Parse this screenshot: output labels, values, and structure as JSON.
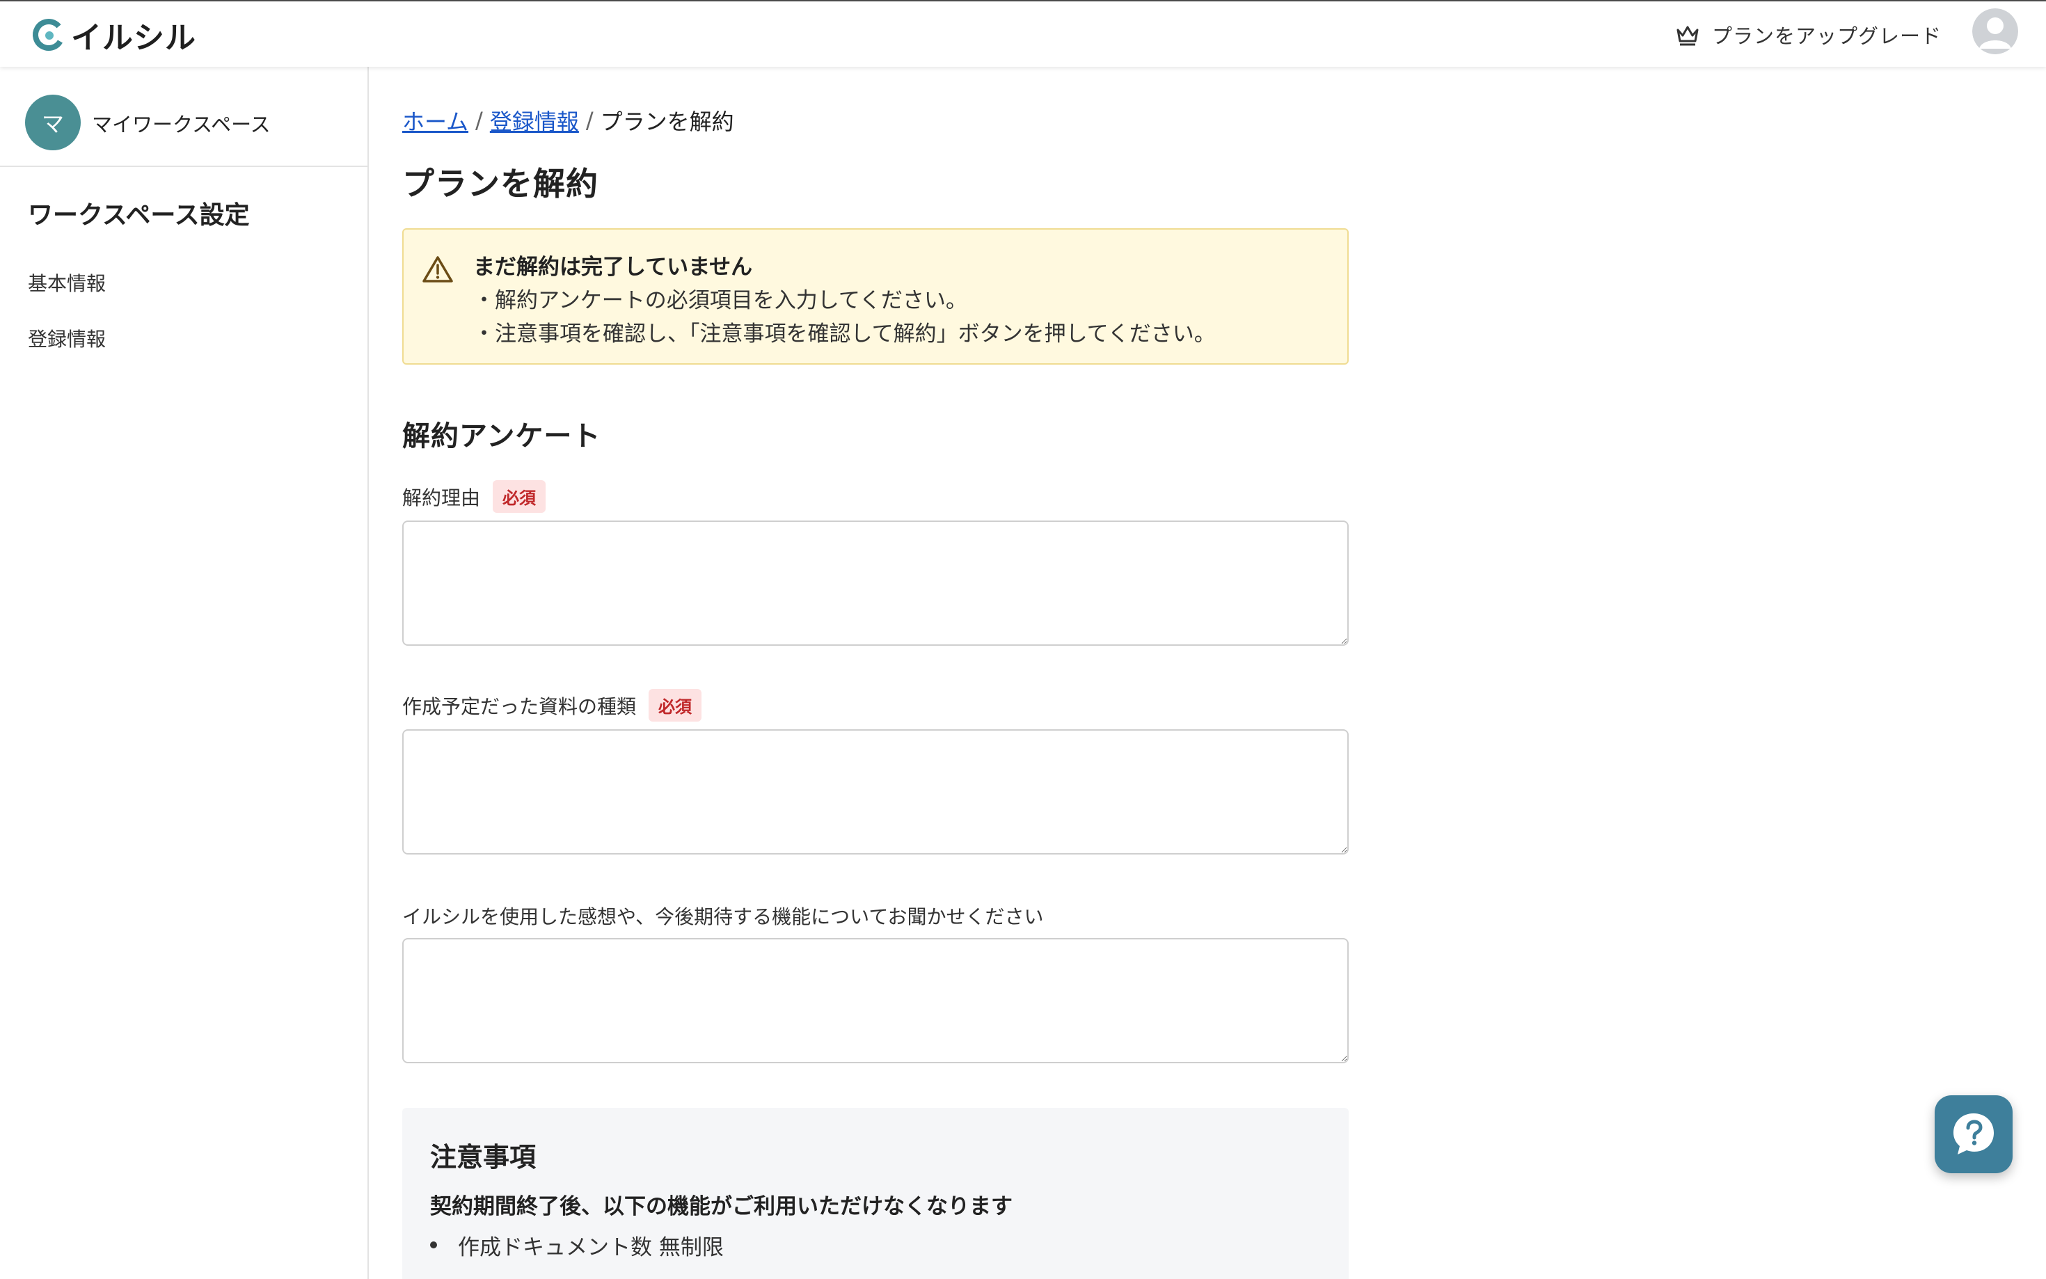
{
  "header": {
    "app_name": "イルシル",
    "upgrade_label": "プランをアップグレード"
  },
  "sidebar": {
    "workspace_initial": "マ",
    "workspace_name": "マイワークスペース",
    "section_title": "ワークスペース設定",
    "items": [
      {
        "label": "基本情報"
      },
      {
        "label": "登録情報"
      }
    ]
  },
  "breadcrumb": {
    "home": "ホーム",
    "registration": "登録情報",
    "current": "プランを解約",
    "separator": "/"
  },
  "page": {
    "title": "プランを解約"
  },
  "alert": {
    "title": "まだ解約は完了していません",
    "lines": [
      "・解約アンケートの必須項目を入力してください。",
      "・注意事項を確認し、「注意事項を確認して解約」ボタンを押してください。"
    ]
  },
  "survey": {
    "title": "解約アンケート",
    "required_label": "必須",
    "fields": [
      {
        "label": "解約理由",
        "value": ""
      },
      {
        "label": "作成予定だった資料の種類",
        "value": ""
      },
      {
        "label": "イルシルを使用した感想や、今後期待する機能についてお聞かせください",
        "value": ""
      }
    ]
  },
  "notice": {
    "title": "注意事項",
    "subtitle": "契約期間終了後、以下の機能がご利用いただけなくなります",
    "items": [
      "作成ドキュメント数 無制限"
    ]
  },
  "colors": {
    "brand_teal": "#4a8f94",
    "link": "#1a57c9",
    "alert_bg": "#fff9df",
    "required_badge": "#c0282a",
    "help_button": "#3e7f9b"
  },
  "icons": {
    "logo": "ilsil-logo-icon",
    "upgrade": "crown-icon",
    "alert": "warning-triangle-icon",
    "help": "question-bubble-icon"
  }
}
